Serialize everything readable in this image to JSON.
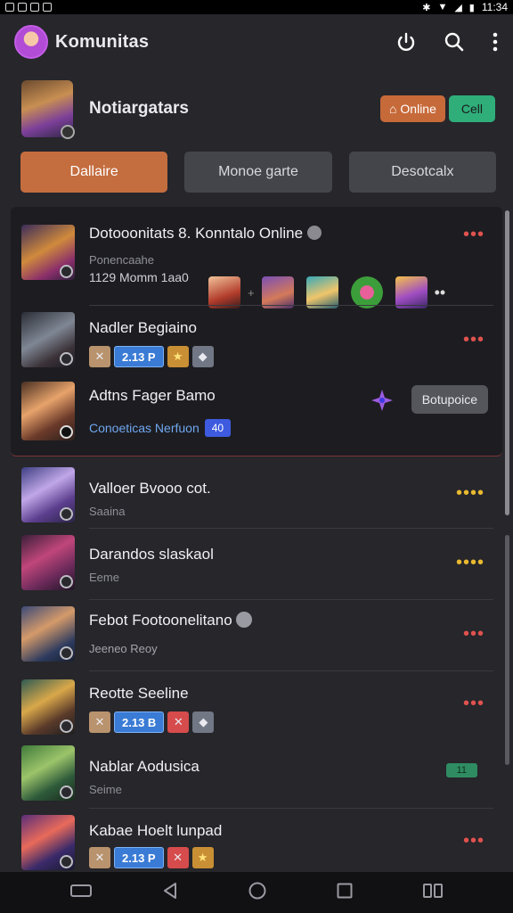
{
  "status": {
    "time": "11:34"
  },
  "app": {
    "title": "Komunitas"
  },
  "profile": {
    "name": "Notiargatars",
    "online_label": "Online",
    "cell_label": "Cell"
  },
  "tabs": [
    {
      "label": "Dallaire",
      "active": true
    },
    {
      "label": "Monoe garte",
      "active": false
    },
    {
      "label": "Desotcalx",
      "active": false
    }
  ],
  "card": {
    "row1": {
      "title": "Dotooonitats 8. Konntalo Online",
      "sub": "Ponencaahe",
      "sub2": "1129 Momm 1aa0"
    },
    "row2": {
      "title": "Nadler Begiaino",
      "badge": "2.13 P"
    },
    "row3": {
      "title": "Adtns Fager Bamo",
      "link": "Conoeticas Nerfuon",
      "link_badge": "40",
      "button": "Botupoice"
    }
  },
  "list": [
    {
      "title": "Valloer Bvooo cot.",
      "sub": "Saaina",
      "dots": "yellow"
    },
    {
      "title": "Darandos slaskaol",
      "sub": "Eeme",
      "dots": "yellow"
    },
    {
      "title": "Febot Footoonelitano",
      "sub": "Jeeneo Reoy",
      "dots": "red"
    },
    {
      "title": "Reotte Seeline",
      "badge": "2.13 B",
      "dots": "red"
    },
    {
      "title": "Nablar Aodusica",
      "sub": "Seime",
      "tag": "11"
    },
    {
      "title": "Kabae Hoelt lunpad",
      "badge": "2.13 P",
      "dots": "red"
    }
  ],
  "colors": {
    "accent": "#c46d3f",
    "online_green": "#2fae7a",
    "danger": "#e0524e",
    "warn": "#e9b92f"
  }
}
